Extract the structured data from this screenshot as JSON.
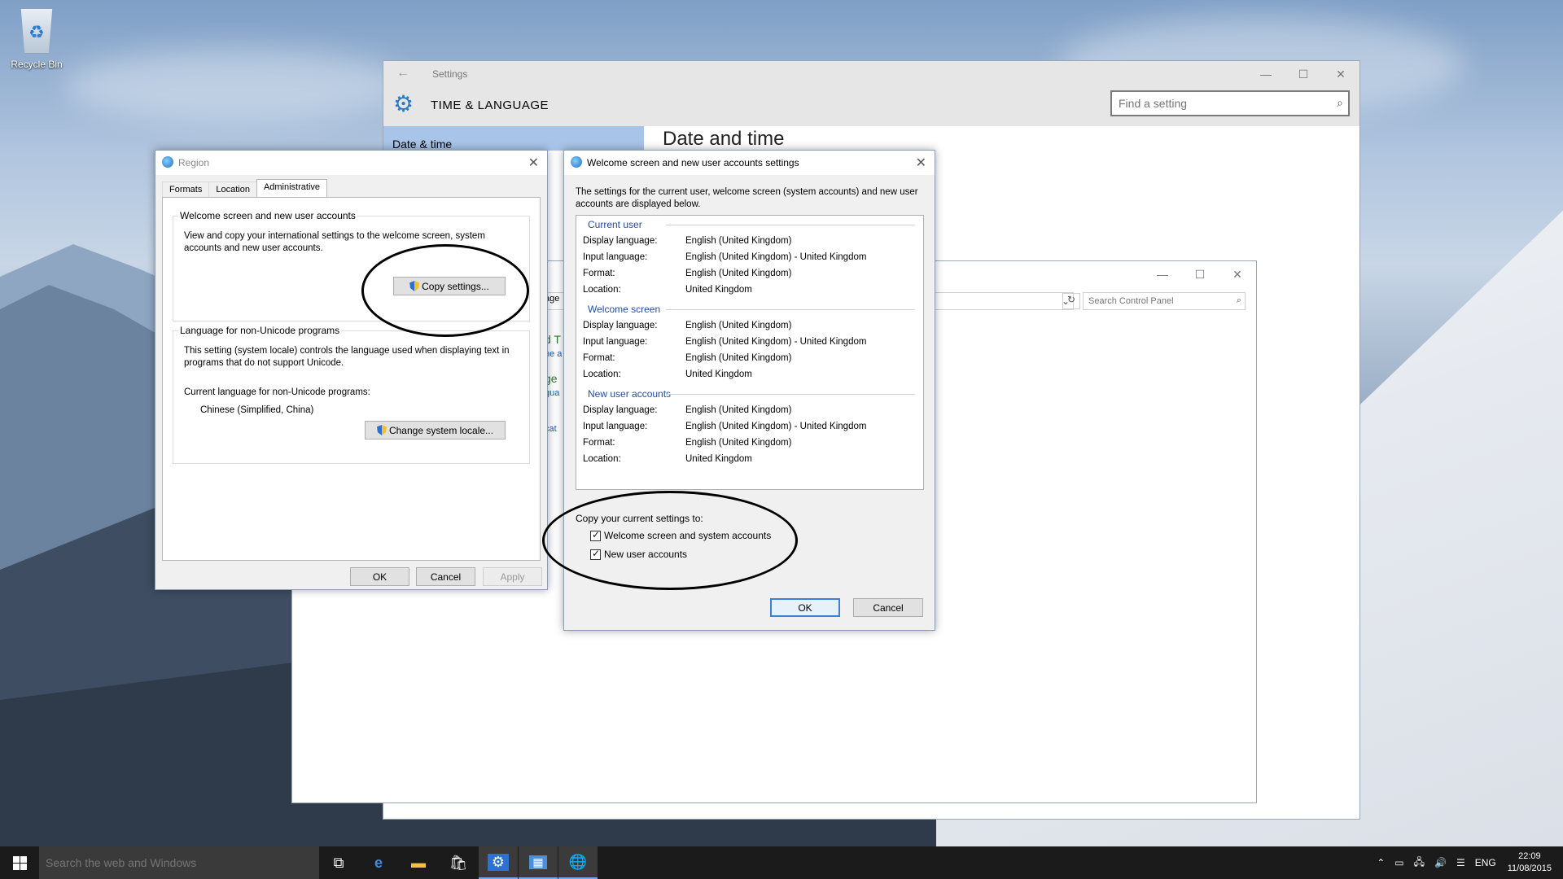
{
  "desktop": {
    "recycle_bin_label": "Recycle Bin"
  },
  "settings": {
    "window_title": "Settings",
    "header_title": "TIME & LANGUAGE",
    "search_placeholder": "Find a setting",
    "nav_selected": "Date & time",
    "content_title": "Date and time"
  },
  "control_panel": {
    "search_placeholder": "Search Control Panel",
    "partial_texts": [
      "age",
      "d T",
      "ne a",
      "ge",
      "gua",
      "cat"
    ]
  },
  "region": {
    "title": "Region",
    "tabs": [
      "Formats",
      "Location",
      "Administrative"
    ],
    "active_tab": "Administrative",
    "group1_title": "Welcome screen and new user accounts",
    "group1_text": "View and copy your international settings to the welcome screen, system accounts and new user accounts.",
    "copy_button": "Copy settings...",
    "group2_title": "Language for non-Unicode programs",
    "group2_text": "This setting (system locale) controls the language used when displaying text in programs that do not support Unicode.",
    "current_label": "Current language for non-Unicode programs:",
    "current_value": "Chinese (Simplified, China)",
    "change_button": "Change system locale...",
    "ok": "OK",
    "cancel": "Cancel",
    "apply": "Apply"
  },
  "welcome": {
    "title": "Welcome screen and new user accounts settings",
    "intro": "The settings for the current user, welcome screen (system accounts) and new user accounts are displayed below.",
    "sections": [
      {
        "heading": "Current user",
        "rows": [
          {
            "k": "Display language:",
            "v": "English (United Kingdom)"
          },
          {
            "k": "Input language:",
            "v": "English (United Kingdom) - United Kingdom"
          },
          {
            "k": "Format:",
            "v": "English (United Kingdom)"
          },
          {
            "k": "Location:",
            "v": "United Kingdom"
          }
        ]
      },
      {
        "heading": "Welcome screen",
        "rows": [
          {
            "k": "Display language:",
            "v": "English (United Kingdom)"
          },
          {
            "k": "Input language:",
            "v": "English (United Kingdom) - United Kingdom"
          },
          {
            "k": "Format:",
            "v": "English (United Kingdom)"
          },
          {
            "k": "Location:",
            "v": "United Kingdom"
          }
        ]
      },
      {
        "heading": "New user accounts",
        "rows": [
          {
            "k": "Display language:",
            "v": "English (United Kingdom)"
          },
          {
            "k": "Input language:",
            "v": "English (United Kingdom) - United Kingdom"
          },
          {
            "k": "Format:",
            "v": "English (United Kingdom)"
          },
          {
            "k": "Location:",
            "v": "United Kingdom"
          }
        ]
      }
    ],
    "copy_to_label": "Copy your current settings to:",
    "check_welcome": "Welcome screen and system accounts",
    "check_new_users": "New user accounts",
    "ok": "OK",
    "cancel": "Cancel"
  },
  "taskbar": {
    "search_placeholder": "Search the web and Windows",
    "language": "ENG",
    "time": "22:09",
    "date": "11/08/2015"
  }
}
